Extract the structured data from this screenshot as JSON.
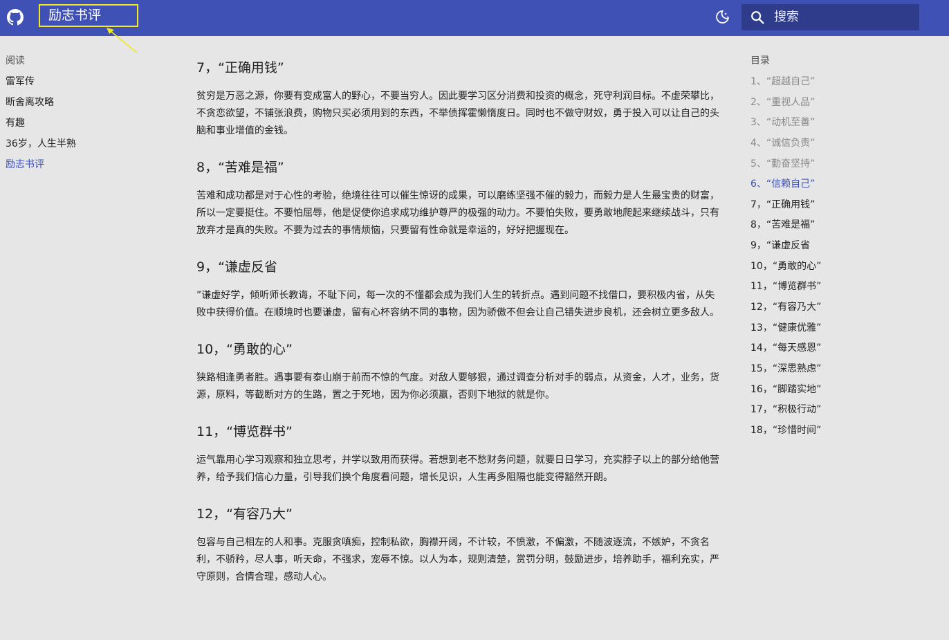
{
  "header": {
    "title": "励志书评",
    "search_placeholder": "搜索",
    "colors": {
      "bar": "#3f51b5",
      "highlight": "#f4e81e"
    }
  },
  "nav": {
    "heading": "阅读",
    "items": [
      {
        "label": "雷军传",
        "active": false
      },
      {
        "label": "断舍离攻略",
        "active": false
      },
      {
        "label": "有趣",
        "active": false
      },
      {
        "label": "36岁，人生半熟",
        "active": false
      },
      {
        "label": "励志书评",
        "active": true
      }
    ]
  },
  "sections": [
    {
      "title": "7，“正确用钱”",
      "body": "贫穷是万恶之源，你要有变成富人的野心，不要当穷人。因此要学习区分消费和投资的概念，死守利润目标。不虚荣攀比，不贪恋欲望，不铺张浪费，购物只买必须用到的东西，不举债挥霍懒惰度日。同时也不做守财奴，勇于投入可以让自己的头脑和事业增值的金钱。"
    },
    {
      "title": "8，“苦难是福”",
      "body": "苦难和成功都是对于心性的考验，绝境往往可以催生惊讶的成果，可以磨练坚强不催的毅力，而毅力是人生最宝贵的财富，所以一定要挺住。不要怕屈辱，他是促使你追求成功维护尊严的极强的动力。不要怕失败，要勇敢地爬起来继续战斗，只有放弃才是真的失败。不要为过去的事情烦恼，只要留有性命就是幸运的，好好把握现在。"
    },
    {
      "title": "9，“谦虚反省",
      "body": "”谦虚好学，倾听师长教诲，不耻下问，每一次的不懂都会成为我们人生的转折点。遇到问题不找借口，要积极内省，从失败中获得价值。在顺境时也要谦虚，留有心杯容纳不同的事物，因为骄傲不但会让自己错失进步良机，还会树立更多敌人。"
    },
    {
      "title": "10，“勇敢的心”",
      "body": "狭路相逢勇者胜。遇事要有泰山崩于前而不惊的气度。对敌人要够狠，通过调查分析对手的弱点，从资金，人才，业务，货源，原料，等截断对方的生路，置之于死地，因为你必须赢，否则下地狱的就是你。"
    },
    {
      "title": "11，“博览群书”",
      "body": "运气靠用心学习观察和独立思考，并学以致用而获得。若想到老不愁财务问题，就要日日学习，充实脖子以上的部分给他营养，给予我们信心力量，引导我们换个角度看问题，增长见识，人生再多阻隔也能变得豁然开朗。"
    },
    {
      "title": "12，“有容乃大”",
      "body": "包容与自己相左的人和事。克服贪嗔痴，控制私欲，胸襟开阔，不计较，不愤激，不偏激，不随波逐流，不嫉妒，不贪名利，不骄矜，尽人事，听天命，不强求，宠辱不惊。以人为本，规则清楚，赏罚分明，鼓励进步，培养助手，福利充实，严守原则，合情合理，感动人心。"
    }
  ],
  "toc": {
    "heading": "目录",
    "items": [
      {
        "label": "1、“超越自己”",
        "state": "faded"
      },
      {
        "label": "2、“重视人品”",
        "state": "faded"
      },
      {
        "label": "3、“动机至善”",
        "state": "faded"
      },
      {
        "label": "4、“诚信负责”",
        "state": "faded"
      },
      {
        "label": "5、“勤奋坚持”",
        "state": "faded"
      },
      {
        "label": "6、“信赖自己”",
        "state": "active"
      },
      {
        "label": "7，“正确用钱”",
        "state": "normal"
      },
      {
        "label": "8，“苦难是福”",
        "state": "normal"
      },
      {
        "label": "9，“谦虚反省",
        "state": "normal"
      },
      {
        "label": "10，“勇敢的心”",
        "state": "normal"
      },
      {
        "label": "11，“博览群书”",
        "state": "normal"
      },
      {
        "label": "12，“有容乃大”",
        "state": "normal"
      },
      {
        "label": "13，“健康优雅”",
        "state": "normal"
      },
      {
        "label": "14，“每天感恩”",
        "state": "normal"
      },
      {
        "label": "15，“深思熟虑”",
        "state": "normal"
      },
      {
        "label": "16，“脚踏实地”",
        "state": "normal"
      },
      {
        "label": "17，“积极行动”",
        "state": "normal"
      },
      {
        "label": "18，“珍惜时间”",
        "state": "normal"
      }
    ]
  }
}
